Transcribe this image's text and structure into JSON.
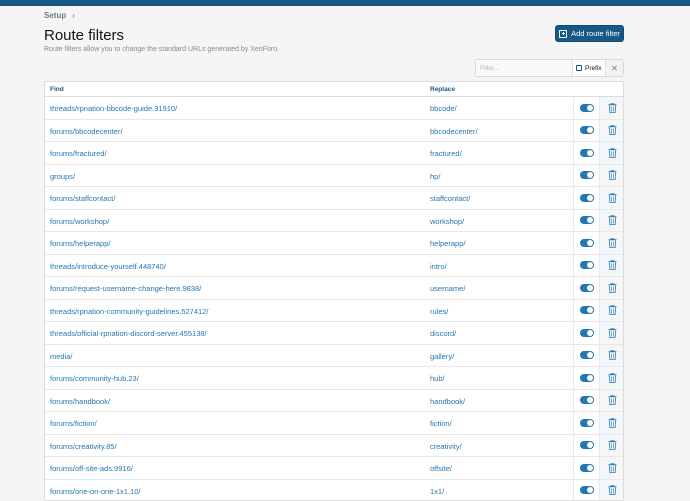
{
  "breadcrumb": {
    "item": "Setup"
  },
  "page": {
    "title": "Route filters",
    "description": "Route filters allow you to change the standard URLs generated by XenForo."
  },
  "toolbar": {
    "add_label": "Add route filter"
  },
  "filter": {
    "placeholder": "Filter...",
    "prefix_label": "Prefix",
    "clear": "✕"
  },
  "table": {
    "headers": {
      "find": "Find",
      "replace": "Replace"
    },
    "rows": [
      {
        "find": "threads/rpnation-bbcode-guide.31910/",
        "replace": "bbcode/",
        "enabled": true
      },
      {
        "find": "forums/bbcodecenter/",
        "replace": "bbcodecenter/",
        "enabled": true
      },
      {
        "find": "forums/fractured/",
        "replace": "fractured/",
        "enabled": true
      },
      {
        "find": "groups/",
        "replace": "hp/",
        "enabled": true
      },
      {
        "find": "forums/staffcontact/",
        "replace": "staffcontact/",
        "enabled": true
      },
      {
        "find": "forums/workshop/",
        "replace": "workshop/",
        "enabled": true
      },
      {
        "find": "forums/helperapp/",
        "replace": "helperapp/",
        "enabled": true
      },
      {
        "find": "threads/introduce-yourself.448740/",
        "replace": "intro/",
        "enabled": true
      },
      {
        "find": "forums/request-username-change-here.9838/",
        "replace": "username/",
        "enabled": true
      },
      {
        "find": "threads/rpnation-community-guidelines.527412/",
        "replace": "rules/",
        "enabled": true
      },
      {
        "find": "threads/official-rpnation-discord-server.455138/",
        "replace": "discord/",
        "enabled": true
      },
      {
        "find": "media/",
        "replace": "gallery/",
        "enabled": true
      },
      {
        "find": "forums/community-hub.23/",
        "replace": "hub/",
        "enabled": true
      },
      {
        "find": "forums/handbook/",
        "replace": "handbook/",
        "enabled": true
      },
      {
        "find": "forums/fiction/",
        "replace": "fiction/",
        "enabled": true
      },
      {
        "find": "forums/creativity.85/",
        "replace": "creativity/",
        "enabled": true
      },
      {
        "find": "forums/off-site-ads.9916/",
        "replace": "offsite/",
        "enabled": true
      },
      {
        "find": "forums/one-on-one-1x1.10/",
        "replace": "1x1/",
        "enabled": true
      }
    ]
  },
  "colors": {
    "accent": "#185886",
    "link": "#2577b1"
  }
}
